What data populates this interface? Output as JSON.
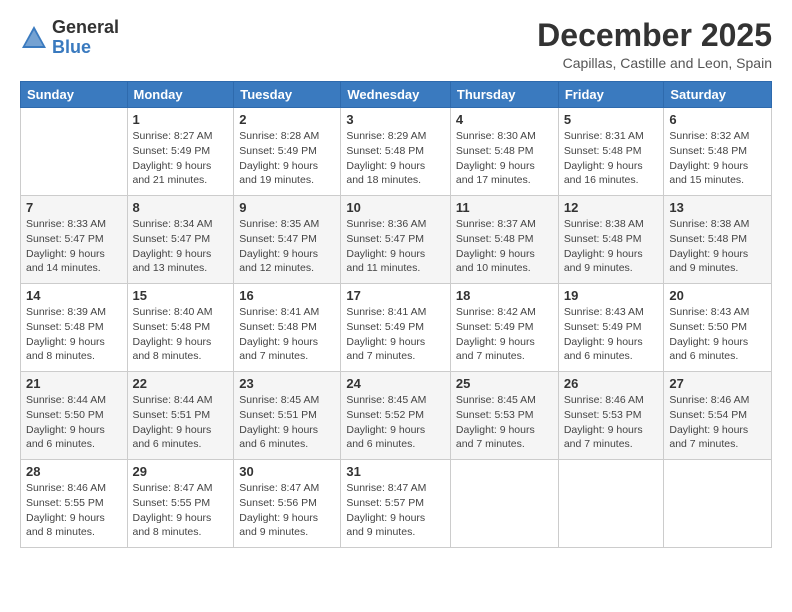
{
  "logo": {
    "general": "General",
    "blue": "Blue"
  },
  "header": {
    "month": "December 2025",
    "location": "Capillas, Castille and Leon, Spain"
  },
  "weekdays": [
    "Sunday",
    "Monday",
    "Tuesday",
    "Wednesday",
    "Thursday",
    "Friday",
    "Saturday"
  ],
  "weeks": [
    [
      {
        "day": "",
        "info": ""
      },
      {
        "day": "1",
        "info": "Sunrise: 8:27 AM\nSunset: 5:49 PM\nDaylight: 9 hours\nand 21 minutes."
      },
      {
        "day": "2",
        "info": "Sunrise: 8:28 AM\nSunset: 5:49 PM\nDaylight: 9 hours\nand 19 minutes."
      },
      {
        "day": "3",
        "info": "Sunrise: 8:29 AM\nSunset: 5:48 PM\nDaylight: 9 hours\nand 18 minutes."
      },
      {
        "day": "4",
        "info": "Sunrise: 8:30 AM\nSunset: 5:48 PM\nDaylight: 9 hours\nand 17 minutes."
      },
      {
        "day": "5",
        "info": "Sunrise: 8:31 AM\nSunset: 5:48 PM\nDaylight: 9 hours\nand 16 minutes."
      },
      {
        "day": "6",
        "info": "Sunrise: 8:32 AM\nSunset: 5:48 PM\nDaylight: 9 hours\nand 15 minutes."
      }
    ],
    [
      {
        "day": "7",
        "info": "Sunrise: 8:33 AM\nSunset: 5:47 PM\nDaylight: 9 hours\nand 14 minutes."
      },
      {
        "day": "8",
        "info": "Sunrise: 8:34 AM\nSunset: 5:47 PM\nDaylight: 9 hours\nand 13 minutes."
      },
      {
        "day": "9",
        "info": "Sunrise: 8:35 AM\nSunset: 5:47 PM\nDaylight: 9 hours\nand 12 minutes."
      },
      {
        "day": "10",
        "info": "Sunrise: 8:36 AM\nSunset: 5:47 PM\nDaylight: 9 hours\nand 11 minutes."
      },
      {
        "day": "11",
        "info": "Sunrise: 8:37 AM\nSunset: 5:48 PM\nDaylight: 9 hours\nand 10 minutes."
      },
      {
        "day": "12",
        "info": "Sunrise: 8:38 AM\nSunset: 5:48 PM\nDaylight: 9 hours\nand 9 minutes."
      },
      {
        "day": "13",
        "info": "Sunrise: 8:38 AM\nSunset: 5:48 PM\nDaylight: 9 hours\nand 9 minutes."
      }
    ],
    [
      {
        "day": "14",
        "info": "Sunrise: 8:39 AM\nSunset: 5:48 PM\nDaylight: 9 hours\nand 8 minutes."
      },
      {
        "day": "15",
        "info": "Sunrise: 8:40 AM\nSunset: 5:48 PM\nDaylight: 9 hours\nand 8 minutes."
      },
      {
        "day": "16",
        "info": "Sunrise: 8:41 AM\nSunset: 5:48 PM\nDaylight: 9 hours\nand 7 minutes."
      },
      {
        "day": "17",
        "info": "Sunrise: 8:41 AM\nSunset: 5:49 PM\nDaylight: 9 hours\nand 7 minutes."
      },
      {
        "day": "18",
        "info": "Sunrise: 8:42 AM\nSunset: 5:49 PM\nDaylight: 9 hours\nand 7 minutes."
      },
      {
        "day": "19",
        "info": "Sunrise: 8:43 AM\nSunset: 5:49 PM\nDaylight: 9 hours\nand 6 minutes."
      },
      {
        "day": "20",
        "info": "Sunrise: 8:43 AM\nSunset: 5:50 PM\nDaylight: 9 hours\nand 6 minutes."
      }
    ],
    [
      {
        "day": "21",
        "info": "Sunrise: 8:44 AM\nSunset: 5:50 PM\nDaylight: 9 hours\nand 6 minutes."
      },
      {
        "day": "22",
        "info": "Sunrise: 8:44 AM\nSunset: 5:51 PM\nDaylight: 9 hours\nand 6 minutes."
      },
      {
        "day": "23",
        "info": "Sunrise: 8:45 AM\nSunset: 5:51 PM\nDaylight: 9 hours\nand 6 minutes."
      },
      {
        "day": "24",
        "info": "Sunrise: 8:45 AM\nSunset: 5:52 PM\nDaylight: 9 hours\nand 6 minutes."
      },
      {
        "day": "25",
        "info": "Sunrise: 8:45 AM\nSunset: 5:53 PM\nDaylight: 9 hours\nand 7 minutes."
      },
      {
        "day": "26",
        "info": "Sunrise: 8:46 AM\nSunset: 5:53 PM\nDaylight: 9 hours\nand 7 minutes."
      },
      {
        "day": "27",
        "info": "Sunrise: 8:46 AM\nSunset: 5:54 PM\nDaylight: 9 hours\nand 7 minutes."
      }
    ],
    [
      {
        "day": "28",
        "info": "Sunrise: 8:46 AM\nSunset: 5:55 PM\nDaylight: 9 hours\nand 8 minutes."
      },
      {
        "day": "29",
        "info": "Sunrise: 8:47 AM\nSunset: 5:55 PM\nDaylight: 9 hours\nand 8 minutes."
      },
      {
        "day": "30",
        "info": "Sunrise: 8:47 AM\nSunset: 5:56 PM\nDaylight: 9 hours\nand 9 minutes."
      },
      {
        "day": "31",
        "info": "Sunrise: 8:47 AM\nSunset: 5:57 PM\nDaylight: 9 hours\nand 9 minutes."
      },
      {
        "day": "",
        "info": ""
      },
      {
        "day": "",
        "info": ""
      },
      {
        "day": "",
        "info": ""
      }
    ]
  ]
}
